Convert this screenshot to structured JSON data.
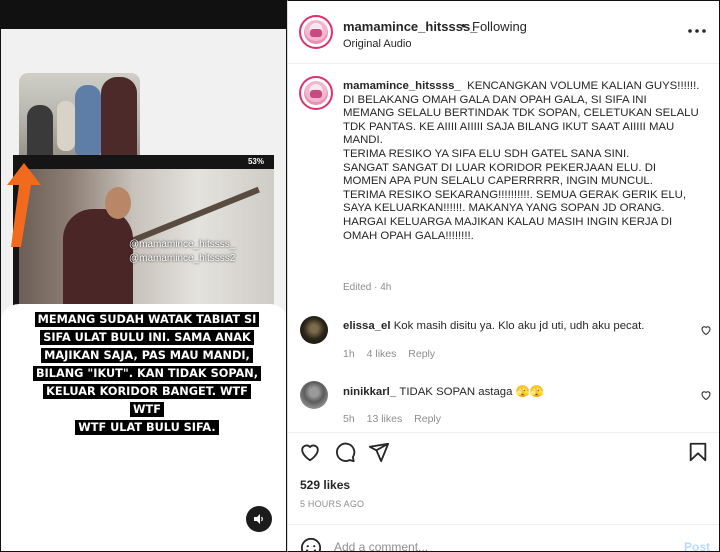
{
  "media": {
    "watermark_1": "@mamamince_hitssss_",
    "watermark_2": "@mamamince_hitssss2",
    "phone_status": "53%",
    "caption_lines": [
      "MEMANG SUDAH WATAK TABIAT SI",
      "SIFA ULAT BULU INI. SAMA ANAK",
      "MAJIKAN SAJA, PAS MAU MANDI,",
      "BILANG \"IKUT\". KAN TIDAK SOPAN,",
      "KELUAR KORIDOR BANGET. WTF WTF",
      "WTF ULAT BULU SIFA."
    ],
    "sound_icon": "speaker-icon"
  },
  "header": {
    "username": "mamamince_hitssss_",
    "separator": "•",
    "follow_status": "Following",
    "audio": "Original Audio",
    "more_icon": "more-horizontal-icon"
  },
  "post": {
    "username": "mamamince_hitssss_",
    "caption_lines": [
      "KENCANGKAN VOLUME KALIAN GUYS!!!!!!.",
      "DI BELAKANG OMAH GALA DAN OPAH GALA, SI SIFA INI",
      "MEMANG SELALU BERTINDAK TDK SOPAN, CELETUKAN SELALU",
      "TDK PANTAS. KE AIIII AIIIII SAJA BILANG IKUT SAAT AIIIII MAU",
      "MANDI.",
      "TERIMA RESIKO YA SIFA ELU SDH GATEL SANA SINI.",
      "SANGAT SANGAT DI LUAR KORIDOR PEKERJAAN ELU. DI",
      "MOMEN APA PUN SELALU CAPERRRRR, INGIN MUNCUL.",
      "TERIMA RESIKO SEKARANG!!!!!!!!!!. SEMUA GERAK GERIK ELU,",
      "SAYA KELUARKAN!!!!!!. MAKANYA YANG SOPAN JD ORANG.",
      "HARGAI KELUARGA MAJIKAN KALAU MASIH INGIN KERJA DI",
      "OMAH OPAH GALA!!!!!!!!."
    ],
    "meta": "Edited · 4h"
  },
  "comments": [
    {
      "username": "elissa_el",
      "text": "Kok masih disitu ya. Klo aku jd uti, udh aku pecat.",
      "age": "1h",
      "likes": "4 likes",
      "reply": "Reply"
    },
    {
      "username": "ninikkarl_",
      "text": "TIDAK SOPAN astaga 🫣🫣",
      "age": "5h",
      "likes": "13 likes",
      "reply": "Reply"
    }
  ],
  "actions": {
    "icons": [
      "heart-icon",
      "comment-icon",
      "share-icon",
      "bookmark-icon"
    ],
    "likes": "529 likes",
    "time_ago": "5 HOURS AGO"
  },
  "add_comment": {
    "placeholder": "Add a comment...",
    "post_label": "Post"
  },
  "colors": {
    "follow_ring": "#e1306c",
    "orange_arrow": "#f26a1e",
    "post_disabled": "#b3dbff",
    "muted_text": "#8e8e8e"
  }
}
